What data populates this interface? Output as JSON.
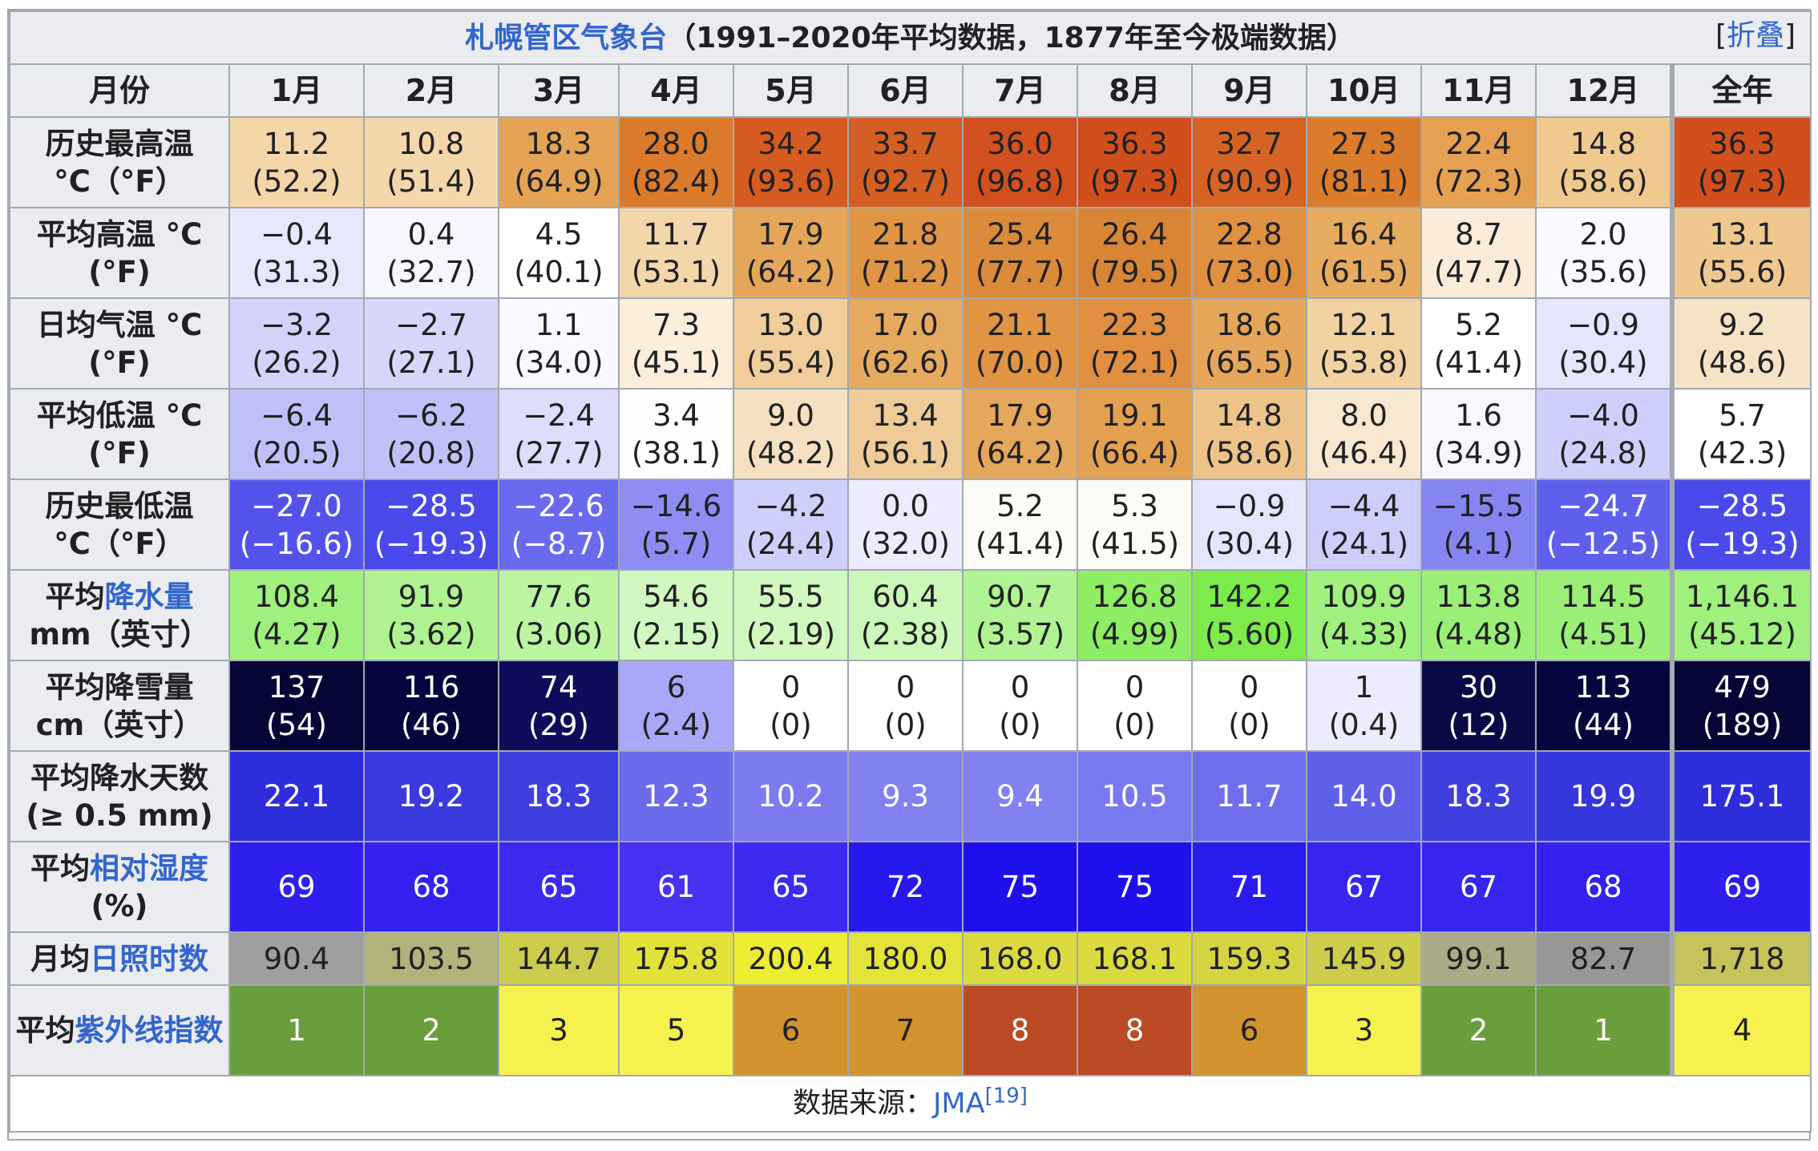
{
  "caption": {
    "station": "札幌管区气象台",
    "period": "（1991–2020年平均数据，1877年至今极端数据）",
    "toggle_open": "[",
    "toggle": "折叠",
    "toggle_close": "]"
  },
  "header": {
    "corner": "月份",
    "months": [
      "1月",
      "2月",
      "3月",
      "4月",
      "5月",
      "6月",
      "7月",
      "8月",
      "9月",
      "10月",
      "11月",
      "12月"
    ],
    "year": "全年"
  },
  "rows": [
    {
      "label": [
        "历史最高温",
        "",
        "\n°C（°F）"
      ],
      "values": [
        "11.2\n(52.2)",
        "10.8\n(51.4)",
        "18.3\n(64.9)",
        "28.0\n(82.4)",
        "34.2\n(93.6)",
        "33.7\n(92.7)",
        "36.0\n(96.8)",
        "36.3\n(97.3)",
        "32.7\n(90.9)",
        "27.3\n(81.1)",
        "22.4\n(72.3)",
        "14.8\n(58.6)",
        "36.3\n(97.3)"
      ],
      "colors": [
        "#f4d6a9",
        "#f4d7aa",
        "#e5a355",
        "#da7a2a",
        "#d55b21",
        "#d55e22",
        "#d2501d",
        "#d14f1d",
        "#d66324",
        "#db7c2c",
        "#e6a051",
        "#f0c98e",
        "#d14f1d"
      ],
      "dark": [
        false,
        false,
        false,
        false,
        false,
        false,
        false,
        false,
        false,
        false,
        false,
        false,
        false
      ]
    },
    {
      "label": [
        "平均高温 °C",
        "",
        "\n(°F)"
      ],
      "values": [
        "−0.4\n(31.3)",
        "0.4\n(32.7)",
        "4.5\n(40.1)",
        "11.7\n(53.1)",
        "17.9\n(64.2)",
        "21.8\n(71.2)",
        "25.4\n(77.7)",
        "26.4\n(79.5)",
        "22.8\n(73.0)",
        "16.4\n(61.5)",
        "8.7\n(47.7)",
        "2.0\n(35.6)",
        "13.1\n(55.6)"
      ],
      "colors": [
        "#e7e7fd",
        "#f6f6ff",
        "#ffffff",
        "#f3d6aa",
        "#e5a659",
        "#e09545",
        "#db8a39",
        "#d98536",
        "#df9040",
        "#e7ab60",
        "#faecd9",
        "#f9f9ff",
        "#f0c88f"
      ],
      "dark": [
        false,
        false,
        false,
        false,
        false,
        false,
        false,
        false,
        false,
        false,
        false,
        false,
        false
      ]
    },
    {
      "label": [
        "日均气温 °C",
        "",
        "\n(°F)"
      ],
      "values": [
        "−3.2\n(26.2)",
        "−2.7\n(27.1)",
        "1.1\n(34.0)",
        "7.3\n(45.1)",
        "13.0\n(55.4)",
        "17.0\n(62.6)",
        "21.1\n(70.0)",
        "22.3\n(72.1)",
        "18.6\n(65.5)",
        "12.1\n(53.8)",
        "5.2\n(41.4)",
        "−0.9\n(30.4)",
        "9.2\n(48.6)"
      ],
      "colors": [
        "#d3d3fb",
        "#d7d7fb",
        "#f9f9ff",
        "#fbeedb",
        "#f0cd9b",
        "#e6aa5e",
        "#e09444",
        "#df8f3f",
        "#e5a65a",
        "#f2d2a1",
        "#ffffff",
        "#e5e5fd",
        "#f6e3c6"
      ],
      "dark": [
        false,
        false,
        false,
        false,
        false,
        false,
        false,
        false,
        false,
        false,
        false,
        false,
        false
      ]
    },
    {
      "label": [
        "平均低温 °C",
        "",
        "\n(°F)"
      ],
      "values": [
        "−6.4\n(20.5)",
        "−6.2\n(20.8)",
        "−2.4\n(27.7)",
        "3.4\n(38.1)",
        "9.0\n(48.2)",
        "13.4\n(56.1)",
        "17.9\n(64.2)",
        "19.1\n(66.4)",
        "14.8\n(58.6)",
        "8.0\n(46.4)",
        "1.6\n(34.9)",
        "−4.0\n(24.8)",
        "5.7\n(42.3)"
      ],
      "colors": [
        "#c0c0f9",
        "#c1c1f9",
        "#dedefc",
        "#fefefe",
        "#f5e0c2",
        "#eecb97",
        "#e5a75b",
        "#e3a051",
        "#edc38a",
        "#f8e8d1",
        "#f7f7ff",
        "#cfcffb",
        "#ffffff"
      ],
      "dark": [
        false,
        false,
        false,
        false,
        false,
        false,
        false,
        false,
        false,
        false,
        false,
        false,
        false
      ]
    },
    {
      "label": [
        "历史最低温",
        "",
        "\n°C（°F）"
      ],
      "values": [
        "−27.0\n(−16.6)",
        "−28.5\n(−19.3)",
        "−22.6\n(−8.7)",
        "−14.6\n(5.7)",
        "−4.2\n(24.4)",
        "0.0\n(32.0)",
        "5.2\n(41.4)",
        "5.3\n(41.5)",
        "−0.9\n(30.4)",
        "−4.4\n(24.1)",
        "−15.5\n(4.1)",
        "−24.7\n(−12.5)",
        "−28.5\n(−19.3)"
      ],
      "colors": [
        "#5353ec",
        "#4a4aea",
        "#6a6aef",
        "#8d8df3",
        "#cfcffb",
        "#ececfe",
        "#fdfbf6",
        "#fdfbf5",
        "#e5e5fd",
        "#cecefb",
        "#8585f2",
        "#5f5fee",
        "#4a4aea"
      ],
      "dark": [
        true,
        true,
        true,
        false,
        false,
        false,
        false,
        false,
        false,
        false,
        false,
        true,
        true
      ]
    },
    {
      "label": [
        "平均",
        "降水量",
        "\nmm（英寸）"
      ],
      "values": [
        "108.4\n(4.27)",
        "91.9\n(3.62)",
        "77.6\n(3.06)",
        "54.6\n(2.15)",
        "55.5\n(2.19)",
        "60.4\n(2.38)",
        "90.7\n(3.57)",
        "126.8\n(4.99)",
        "142.2\n(5.60)",
        "109.9\n(4.33)",
        "113.8\n(4.48)",
        "114.5\n(4.51)",
        "1,146.1\n(45.12)"
      ],
      "colors": [
        "#a0f07e",
        "#aff391",
        "#bcf6a2",
        "#d1f8c0",
        "#d0f8bf",
        "#cbf7b8",
        "#b0f392",
        "#8ded63",
        "#7ceb4b",
        "#9ff07c",
        "#9bef77",
        "#9bef76",
        "#9ff07c"
      ],
      "dark": [
        false,
        false,
        false,
        false,
        false,
        false,
        false,
        false,
        false,
        false,
        false,
        false,
        false
      ]
    },
    {
      "label": [
        "平均降雪量",
        "",
        "\ncm（英寸）"
      ],
      "values": [
        "137\n(54)",
        "116\n(46)",
        "74\n(29)",
        "6\n(2.4)",
        "0\n(0)",
        "0\n(0)",
        "0\n(0)",
        "0\n(0)",
        "0\n(0)",
        "1\n(0.4)",
        "30\n(12)",
        "113\n(44)",
        "479\n(189)"
      ],
      "colors": [
        "#050536",
        "#06063e",
        "#0d0d5c",
        "#a8a8f9",
        "#ffffff",
        "#ffffff",
        "#ffffff",
        "#ffffff",
        "#ffffff",
        "#ececfe",
        "#090946",
        "#06063f",
        "#050536"
      ],
      "dark": [
        true,
        true,
        true,
        false,
        false,
        false,
        false,
        false,
        false,
        false,
        true,
        true,
        true
      ]
    },
    {
      "label": [
        "平均降水天数",
        "",
        "\n(≥ 0.5 mm)"
      ],
      "values": [
        "22.1",
        "19.2",
        "18.3",
        "12.3",
        "10.2",
        "9.3",
        "9.4",
        "10.5",
        "11.7",
        "14.0",
        "18.3",
        "19.9",
        "175.1"
      ],
      "colors": [
        "#2d2ddb",
        "#3a3ade",
        "#3f3fe0",
        "#6b6bec",
        "#7b7bef",
        "#8181f1",
        "#8181f1",
        "#7979ef",
        "#6f6fed",
        "#5f5fe8",
        "#3f3fe0",
        "#3636dd",
        "#2d2ddb"
      ],
      "dark": [
        true,
        true,
        true,
        true,
        true,
        true,
        true,
        true,
        true,
        true,
        true,
        true,
        true
      ]
    },
    {
      "label": [
        "平均",
        "相对湿度",
        "\n(%)"
      ],
      "values": [
        "69",
        "68",
        "65",
        "61",
        "65",
        "72",
        "75",
        "75",
        "71",
        "67",
        "67",
        "68",
        "69"
      ],
      "colors": [
        "#2e1fef",
        "#3221ef",
        "#3d2af0",
        "#4732f1",
        "#3d2af0",
        "#2718ee",
        "#1e10ec",
        "#1e10ec",
        "#2a1bee",
        "#3725f0",
        "#3725f0",
        "#3221ef",
        "#2e1fef"
      ],
      "dark": [
        true,
        true,
        true,
        true,
        true,
        true,
        true,
        true,
        true,
        true,
        true,
        true,
        true
      ]
    },
    {
      "label": [
        "月均",
        "日照时数",
        ""
      ],
      "values": [
        "90.4",
        "103.5",
        "144.7",
        "175.8",
        "200.4",
        "180.0",
        "168.0",
        "168.1",
        "159.3",
        "145.9",
        "99.1",
        "82.7",
        "1,718"
      ],
      "colors": [
        "#9e9e9e",
        "#b2b27a",
        "#cccc4c",
        "#e1e13a",
        "#eded33",
        "#e3e339",
        "#dada3e",
        "#dada3e",
        "#d4d443",
        "#cdcd4b",
        "#aaaa86",
        "#979797",
        "#c4c45a"
      ],
      "dark": [
        false,
        false,
        false,
        false,
        false,
        false,
        false,
        false,
        false,
        false,
        false,
        false,
        false
      ]
    },
    {
      "label": [
        "平均",
        "紫外线指数",
        ""
      ],
      "values": [
        "1",
        "2",
        "3",
        "5",
        "6",
        "7",
        "8",
        "8",
        "6",
        "3",
        "2",
        "1",
        "4"
      ],
      "colors": [
        "#6a9e3c",
        "#6a9e3c",
        "#f5f24f",
        "#f5f24f",
        "#d2922d",
        "#d2922d",
        "#bb4b25",
        "#bb4b25",
        "#d2922d",
        "#f5f24f",
        "#6a9e3c",
        "#6a9e3c",
        "#f5f24f"
      ],
      "dark": [
        true,
        true,
        false,
        false,
        false,
        false,
        true,
        true,
        false,
        false,
        true,
        true,
        false
      ]
    }
  ],
  "source": {
    "label": "数据来源：",
    "link": "JMA",
    "ref": "[19]"
  }
}
